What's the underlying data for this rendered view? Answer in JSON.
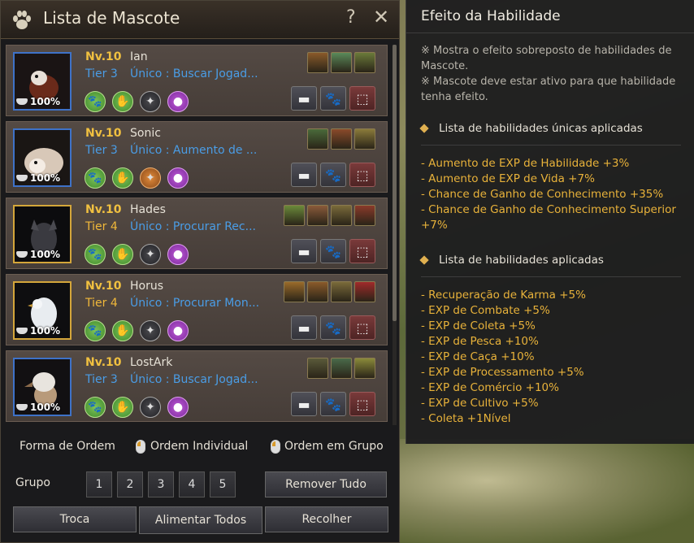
{
  "window": {
    "title": "Lista de Mascote",
    "help": "?",
    "close": "✕"
  },
  "pets": [
    {
      "level": "Nv.10",
      "name": "Ian",
      "tier": "Tier 3",
      "skill": "Único : Buscar Jogad...",
      "hunger": "100%",
      "frame": "blue",
      "talents": [
        "#8a5a2a",
        "#5a8a5a",
        "#6a7a3a"
      ]
    },
    {
      "level": "Nv.10",
      "name": "Sonic",
      "tier": "Tier 3",
      "skill": "Único : Aumento de ...",
      "hunger": "100%",
      "frame": "blue",
      "talents": [
        "#4a6a3a",
        "#8a4a2a",
        "#8a7a3a"
      ]
    },
    {
      "level": "Nv.10",
      "name": "Hades",
      "tier": "Tier 4",
      "skill": "Único : Procurar Rec...",
      "hunger": "100%",
      "frame": "gold",
      "talents": [
        "#6a8a3a",
        "#8a5a3a",
        "#7a6a3a",
        "#8a3a2a"
      ]
    },
    {
      "level": "Nv.10",
      "name": "Horus",
      "tier": "Tier 4",
      "skill": "Único : Procurar Mon...",
      "hunger": "100%",
      "frame": "gold",
      "talents": [
        "#9a6a2a",
        "#8a5a2a",
        "#7a6a3a",
        "#a02a2a"
      ]
    },
    {
      "level": "Nv.10",
      "name": "LostArk",
      "tier": "Tier 3",
      "skill": "Único : Buscar Jogad...",
      "hunger": "100%",
      "frame": "blue",
      "talents": [
        "#5a5a3a",
        "#4a6a4a",
        "#8a8a3a"
      ]
    }
  ],
  "sort": {
    "label": "Forma de Ordem",
    "individual": "Ordem Individual",
    "group": "Ordem em Grupo"
  },
  "group": {
    "label": "Grupo",
    "buttons": [
      "1",
      "2",
      "3",
      "4",
      "5"
    ],
    "remove_all": "Remover Tudo"
  },
  "bottom": {
    "swap": "Troca",
    "feed_all": "Alimentar Todos",
    "collect": "Recolher"
  },
  "info": {
    "title": "Efeito da Habilidade",
    "note1": "※ Mostra o efeito sobreposto de habilidades de Mascote.",
    "note2": "※ Mascote deve estar ativo para que habilidade tenha efeito.",
    "unique_header": "Lista de habilidades únicas aplicadas",
    "unique_effects": [
      "- Aumento de EXP de Habilidade +3%",
      "- Aumento de EXP de Vida +7%",
      "- Chance de Ganho de Conhecimento +35%",
      "- Chance de Ganho de Conhecimento Superior +7%"
    ],
    "applied_header": "Lista de habilidades aplicadas",
    "applied_effects": [
      "- Recuperação de Karma +5%",
      "- EXP de Combate +5%",
      "- EXP de Coleta +5%",
      "- EXP de Pesca +10%",
      "- EXP de Caça +10%",
      "- EXP de Processamento +5%",
      "- EXP de Comércio +10%",
      "- EXP de Cultivo +5%",
      "- Coleta +1Nível"
    ]
  }
}
